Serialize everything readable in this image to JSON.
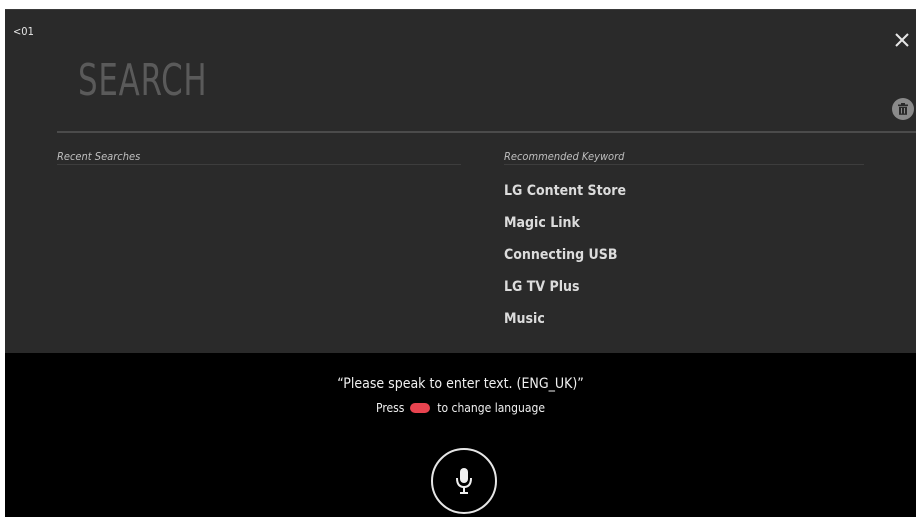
{
  "header": {
    "back_label": "<01",
    "search_title": "SEARCH",
    "close_icon": "close-icon",
    "delete_icon": "trash-icon"
  },
  "recent": {
    "heading": "Recent Searches",
    "items": []
  },
  "recommended": {
    "heading": "Recommended Keyword",
    "items": [
      "LG Content Store",
      "Magic Link",
      "Connecting USB",
      "LG TV Plus",
      "Music"
    ]
  },
  "voice": {
    "prompt": "“Please speak to enter text. (ENG_UK)”",
    "press_label": "Press",
    "change_language_label": "to change language",
    "language_button_color": "#e8434f",
    "mic_icon": "microphone-icon"
  }
}
